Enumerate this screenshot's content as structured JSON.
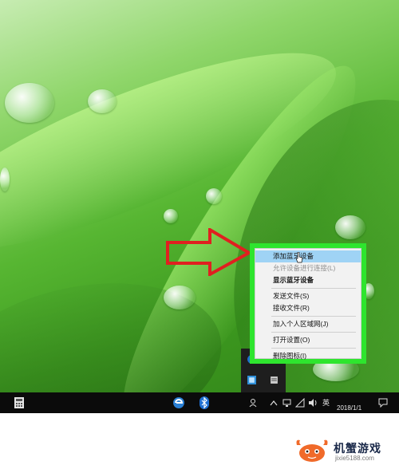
{
  "context_menu": {
    "items": [
      {
        "label": "添加蓝牙设备",
        "state": "highlighted"
      },
      {
        "label": "允许设备进行连接(L)",
        "state": "disabled"
      },
      {
        "label": "显示蓝牙设备",
        "state": "bold"
      },
      {
        "label": "发送文件(S)",
        "state": "normal"
      },
      {
        "label": "接收文件(R)",
        "state": "normal"
      },
      {
        "label": "加入个人区域网(J)",
        "state": "normal"
      },
      {
        "label": "打开设置(O)",
        "state": "normal"
      },
      {
        "label": "删除图标(I)",
        "state": "normal"
      }
    ],
    "highlight_color": "#9fd3f5",
    "frame_color": "#2ee52e"
  },
  "annotation": {
    "arrow_color": "#e02020"
  },
  "taskbar": {
    "ime_label": "英",
    "date": "2018/1/1",
    "icons": [
      "calculator-icon",
      "edge-icon",
      "bluetooth-icon",
      "people-icon",
      "chevron-up-icon",
      "network-icon",
      "wifi-icon",
      "volume-icon",
      "notification-icon"
    ]
  },
  "watermark": {
    "brand": "机蟹游戏",
    "url": "jixie5188.com"
  }
}
